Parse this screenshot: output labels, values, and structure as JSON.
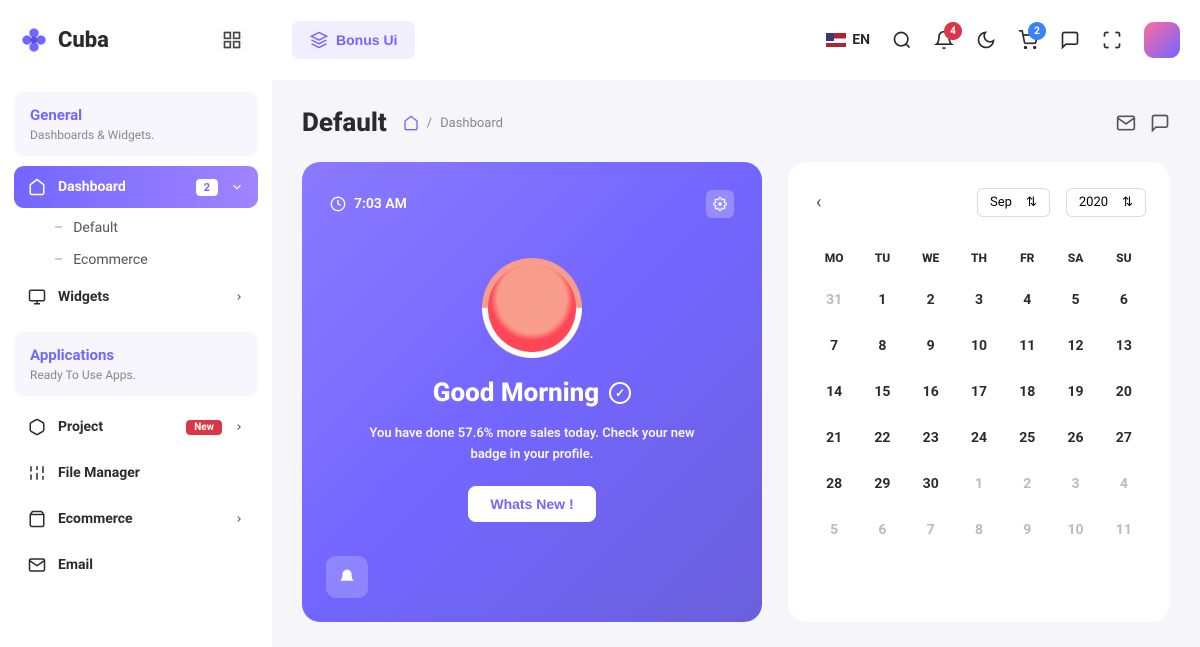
{
  "brand": "Cuba",
  "header": {
    "bonus_label": "Bonus Ui",
    "lang": "EN",
    "bell_count": "4",
    "cart_count": "2"
  },
  "sidebar": {
    "general": {
      "title": "General",
      "subtitle": "Dashboards & Widgets."
    },
    "dashboard": {
      "label": "Dashboard",
      "count": "2"
    },
    "sub_default": "Default",
    "sub_ecommerce": "Ecommerce",
    "widgets": "Widgets",
    "applications": {
      "title": "Applications",
      "subtitle": "Ready To Use Apps."
    },
    "project": {
      "label": "Project",
      "badge": "New"
    },
    "file_manager": "File Manager",
    "ecommerce": "Ecommerce",
    "email": "Email"
  },
  "page": {
    "title": "Default",
    "breadcrumb": "Dashboard"
  },
  "welcome": {
    "time": "7:03 AM",
    "greeting": "Good Morning",
    "desc": "You have done 57.6% more sales today. Check your new badge in your profile.",
    "button": "Whats New !"
  },
  "calendar": {
    "month": "Sep",
    "year": "2020",
    "dow": [
      "MO",
      "TU",
      "WE",
      "TH",
      "FR",
      "SA",
      "SU"
    ],
    "days": [
      {
        "d": "31",
        "m": true
      },
      {
        "d": "1"
      },
      {
        "d": "2"
      },
      {
        "d": "3"
      },
      {
        "d": "4"
      },
      {
        "d": "5"
      },
      {
        "d": "6"
      },
      {
        "d": "7"
      },
      {
        "d": "8"
      },
      {
        "d": "9"
      },
      {
        "d": "10"
      },
      {
        "d": "11"
      },
      {
        "d": "12"
      },
      {
        "d": "13"
      },
      {
        "d": "14"
      },
      {
        "d": "15"
      },
      {
        "d": "16"
      },
      {
        "d": "17"
      },
      {
        "d": "18"
      },
      {
        "d": "19"
      },
      {
        "d": "20"
      },
      {
        "d": "21"
      },
      {
        "d": "22"
      },
      {
        "d": "23"
      },
      {
        "d": "24"
      },
      {
        "d": "25"
      },
      {
        "d": "26"
      },
      {
        "d": "27"
      },
      {
        "d": "28"
      },
      {
        "d": "29"
      },
      {
        "d": "30"
      },
      {
        "d": "1",
        "m": true
      },
      {
        "d": "2",
        "m": true
      },
      {
        "d": "3",
        "m": true
      },
      {
        "d": "4",
        "m": true
      },
      {
        "d": "5",
        "m": true
      },
      {
        "d": "6",
        "m": true
      },
      {
        "d": "7",
        "m": true
      },
      {
        "d": "8",
        "m": true
      },
      {
        "d": "9",
        "m": true
      },
      {
        "d": "10",
        "m": true
      },
      {
        "d": "11",
        "m": true
      }
    ]
  }
}
